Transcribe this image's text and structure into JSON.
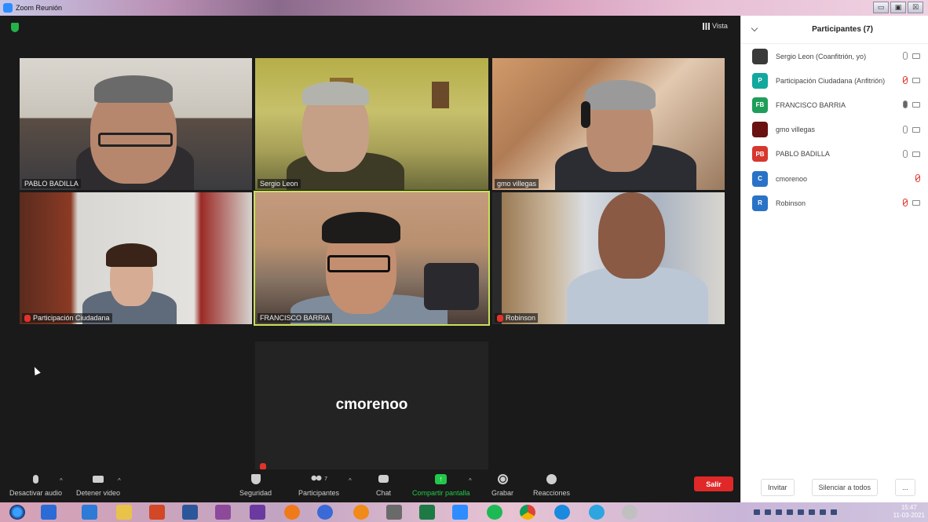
{
  "window": {
    "title": "Zoom Reunión",
    "buttons": [
      "▭",
      "▣",
      "☒"
    ]
  },
  "header": {
    "view_label": "Vista"
  },
  "tiles": [
    {
      "name": "PABLO BADILLA",
      "muted": false
    },
    {
      "name": "Sergio Leon",
      "muted": false
    },
    {
      "name": "gmo villegas",
      "muted": false
    },
    {
      "name": "Participación Ciudadana",
      "muted": true
    },
    {
      "name": "FRANCISCO BARRIA",
      "muted": false
    },
    {
      "name": "Robinson",
      "muted": true
    }
  ],
  "name_only_tile": {
    "name": "cmorenoo"
  },
  "toolbar": {
    "audio": "Desactivar audio",
    "video": "Detener video",
    "security": "Seguridad",
    "participants": "Participantes",
    "participants_count": "7",
    "chat": "Chat",
    "share": "Compartir pantalla",
    "record": "Grabar",
    "reactions": "Reacciones",
    "leave": "Salir"
  },
  "panel": {
    "title": "Participantes (7)",
    "participants": [
      {
        "name": "Sergio Leon (Coanfitrión, yo)",
        "initials": "",
        "color": "#3a3a3a"
      },
      {
        "name": "Participación Ciudadana (Anfitrión)",
        "initials": "P",
        "color": "#12a89d"
      },
      {
        "name": "FRANCISCO BARRIA",
        "initials": "FB",
        "color": "#1e9e5a"
      },
      {
        "name": "gmo villegas",
        "initials": "",
        "color": "#6a1111"
      },
      {
        "name": "PABLO BADILLA",
        "initials": "PB",
        "color": "#d6372f"
      },
      {
        "name": "cmorenoo",
        "initials": "C",
        "color": "#2a72c7"
      },
      {
        "name": "Robinson",
        "initials": "R",
        "color": "#2a72c7"
      }
    ],
    "invite": "Invitar",
    "mute_all": "Silenciar a todos",
    "more": "..."
  },
  "taskbar": {
    "time": "15:47",
    "date": "11-03-2021"
  }
}
